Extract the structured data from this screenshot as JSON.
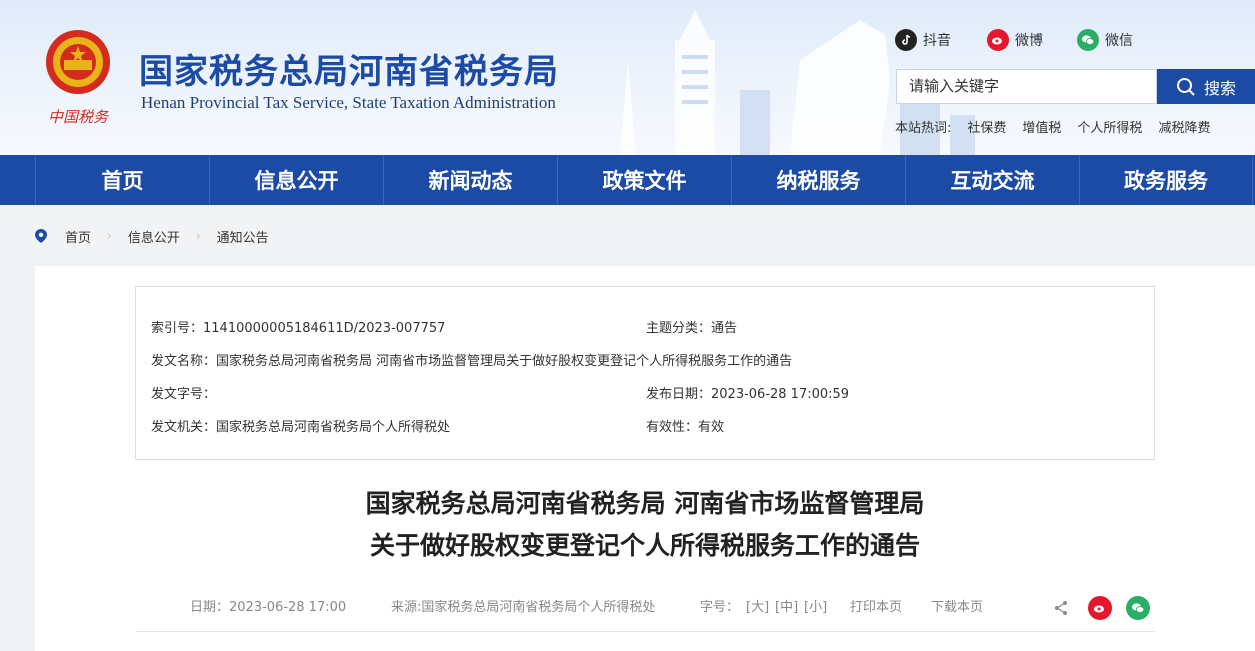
{
  "header": {
    "logo_text": "中国税务",
    "title": "国家税务总局河南省税务局",
    "subtitle": "Henan Provincial Tax Service, State Taxation Administration"
  },
  "social": {
    "douyin": "抖音",
    "weibo": "微博",
    "wechat": "微信"
  },
  "search": {
    "placeholder": "请输入关键字",
    "button": "搜索"
  },
  "hotwords": {
    "label": "本站热词:",
    "items": [
      "社保费",
      "增值税",
      "个人所得税",
      "减税降费"
    ]
  },
  "nav": {
    "items": [
      "首页",
      "信息公开",
      "新闻动态",
      "政策文件",
      "纳税服务",
      "互动交流",
      "政务服务"
    ]
  },
  "breadcrumb": {
    "items": [
      "首页",
      "信息公开",
      "通知公告"
    ]
  },
  "meta": {
    "index_no": "索引号：11410000005184611D/2023-007757",
    "topic": "主题分类：通告",
    "doc_name": "发文名称：国家税务总局河南省税务局 河南省市场监督管理局关于做好股权变更登记个人所得税服务工作的通告",
    "doc_no": "发文字号：",
    "publish_date": "发布日期：2023-06-28 17:00:59",
    "issuer": "发文机关：国家税务总局河南省税务局个人所得税处",
    "validity": "有效性：有效"
  },
  "article": {
    "title_line1": "国家税务总局河南省税务局 河南省市场监督管理局",
    "title_line2": "关于做好股权变更登记个人所得税服务工作的通告",
    "date": "日期：2023-06-28 17:00",
    "source": "来源:国家税务总局河南省税务局个人所得税处",
    "font_label": "字号：",
    "font_large": "[大]",
    "font_medium": "[中]",
    "font_small": "[小]",
    "print": "打印本页",
    "download": "下载本页"
  },
  "colors": {
    "primary": "#1c4ba5",
    "weibo": "#e6162d",
    "wechat": "#2aae67"
  }
}
